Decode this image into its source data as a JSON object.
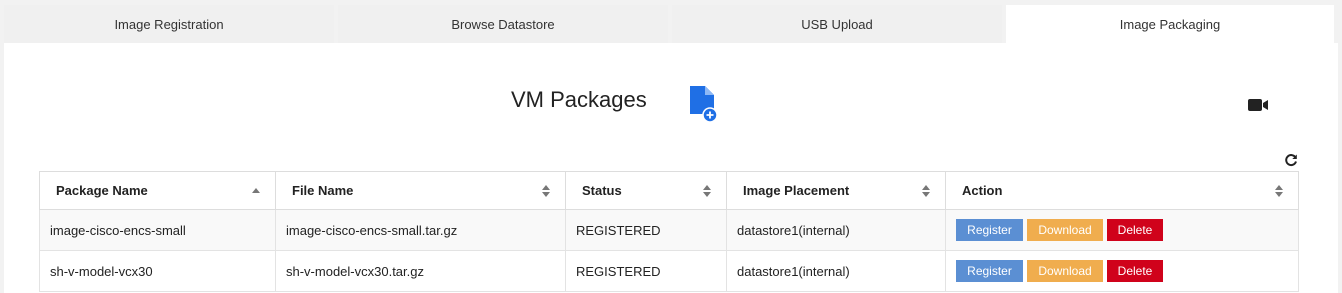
{
  "tabs": [
    {
      "label": "Image Registration",
      "active": false
    },
    {
      "label": "Browse Datastore",
      "active": false
    },
    {
      "label": "USB Upload",
      "active": false
    },
    {
      "label": "Image Packaging",
      "active": true
    }
  ],
  "page": {
    "title": "VM Packages",
    "add_icon": "file-add-icon",
    "video_icon": "video-camera-icon",
    "refresh_icon": "refresh-icon"
  },
  "colors": {
    "accent_blue": "#1f6fe5",
    "register": "#5b8fd3",
    "download": "#f0ad4e",
    "delete": "#d0021b"
  },
  "table": {
    "columns": [
      "Package Name",
      "File Name",
      "Status",
      "Image Placement",
      "Action"
    ],
    "rows": [
      {
        "package_name": "image-cisco-encs-small",
        "file_name": "image-cisco-encs-small.tar.gz",
        "status": "REGISTERED",
        "placement": "datastore1(internal)"
      },
      {
        "package_name": "sh-v-model-vcx30",
        "file_name": "sh-v-model-vcx30.tar.gz",
        "status": "REGISTERED",
        "placement": "datastore1(internal)"
      }
    ],
    "actions": {
      "register": "Register",
      "download": "Download",
      "delete": "Delete"
    }
  }
}
